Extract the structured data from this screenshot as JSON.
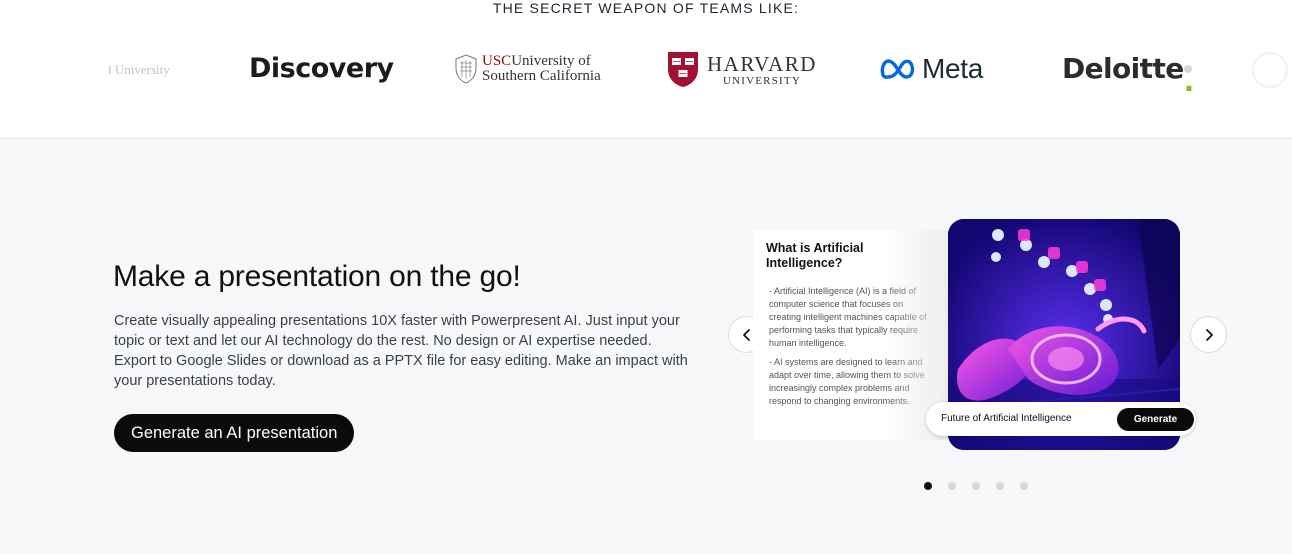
{
  "logos_band": {
    "heading": "THE SECRET WEAPON OF TEAMS LIKE:",
    "logos": [
      {
        "name": "partial-university",
        "text": "l University"
      },
      {
        "name": "discovery",
        "text": "Discovery"
      },
      {
        "name": "usc",
        "abbr": "USC",
        "line1": "University of",
        "line2": "Southern California"
      },
      {
        "name": "harvard",
        "line1": "HARVARD",
        "line2": "UNIVERSITY"
      },
      {
        "name": "meta",
        "text": "Meta"
      },
      {
        "name": "deloitte",
        "text": "Deloitte",
        "dot": "."
      }
    ]
  },
  "hero": {
    "headline": "Make a presentation on the go!",
    "description": "Create visually appealing presentations 10X faster with Powerpresent AI. Just input your topic or text and let our AI technology do the rest. No design or AI expertise needed. Export to Google Slides or download as a PPTX file for easy editing. Make an impact with your presentations today.",
    "cta_label": "Generate an AI presentation"
  },
  "carousel": {
    "slide": {
      "title": "What is Artificial Intelligence?",
      "bullets": [
        "- Artificial Intelligence (AI) is a field of computer science that focuses on creating intelligent machines capable of performing tasks that typically require human intelligence.",
        "- AI systems are designed to learn and adapt over time, allowing them to solve increasingly complex problems and respond to changing environments."
      ]
    },
    "prompt_value": "Future of Artificial Intelligence",
    "generate_label": "Generate",
    "prev_icon": "chevron-left-icon",
    "next_icon": "chevron-right-icon",
    "dots_count": 5,
    "active_dot": 1
  },
  "colors": {
    "background_section": "#f7f8fa",
    "button_black": "#0b0b0b",
    "usc_red": "#990000",
    "harvard_red": "#a41034",
    "meta_blue": "#0668e1",
    "deloitte_green": "#86bc25",
    "image_purple": "#1a0b73",
    "image_magenta": "#ff2bd6"
  }
}
